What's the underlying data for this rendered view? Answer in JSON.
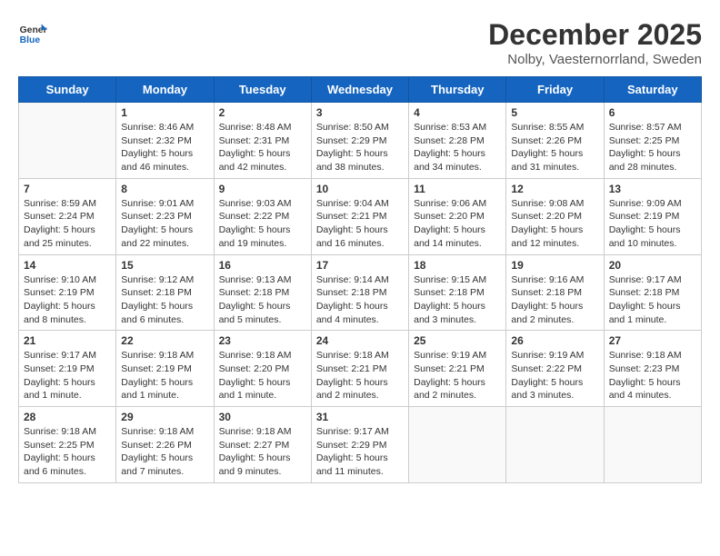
{
  "header": {
    "logo_line1": "General",
    "logo_line2": "Blue",
    "month": "December 2025",
    "location": "Nolby, Vaesternorrland, Sweden"
  },
  "days_of_week": [
    "Sunday",
    "Monday",
    "Tuesday",
    "Wednesday",
    "Thursday",
    "Friday",
    "Saturday"
  ],
  "weeks": [
    [
      {
        "day": "",
        "info": ""
      },
      {
        "day": "1",
        "info": "Sunrise: 8:46 AM\nSunset: 2:32 PM\nDaylight: 5 hours\nand 46 minutes."
      },
      {
        "day": "2",
        "info": "Sunrise: 8:48 AM\nSunset: 2:31 PM\nDaylight: 5 hours\nand 42 minutes."
      },
      {
        "day": "3",
        "info": "Sunrise: 8:50 AM\nSunset: 2:29 PM\nDaylight: 5 hours\nand 38 minutes."
      },
      {
        "day": "4",
        "info": "Sunrise: 8:53 AM\nSunset: 2:28 PM\nDaylight: 5 hours\nand 34 minutes."
      },
      {
        "day": "5",
        "info": "Sunrise: 8:55 AM\nSunset: 2:26 PM\nDaylight: 5 hours\nand 31 minutes."
      },
      {
        "day": "6",
        "info": "Sunrise: 8:57 AM\nSunset: 2:25 PM\nDaylight: 5 hours\nand 28 minutes."
      }
    ],
    [
      {
        "day": "7",
        "info": "Sunrise: 8:59 AM\nSunset: 2:24 PM\nDaylight: 5 hours\nand 25 minutes."
      },
      {
        "day": "8",
        "info": "Sunrise: 9:01 AM\nSunset: 2:23 PM\nDaylight: 5 hours\nand 22 minutes."
      },
      {
        "day": "9",
        "info": "Sunrise: 9:03 AM\nSunset: 2:22 PM\nDaylight: 5 hours\nand 19 minutes."
      },
      {
        "day": "10",
        "info": "Sunrise: 9:04 AM\nSunset: 2:21 PM\nDaylight: 5 hours\nand 16 minutes."
      },
      {
        "day": "11",
        "info": "Sunrise: 9:06 AM\nSunset: 2:20 PM\nDaylight: 5 hours\nand 14 minutes."
      },
      {
        "day": "12",
        "info": "Sunrise: 9:08 AM\nSunset: 2:20 PM\nDaylight: 5 hours\nand 12 minutes."
      },
      {
        "day": "13",
        "info": "Sunrise: 9:09 AM\nSunset: 2:19 PM\nDaylight: 5 hours\nand 10 minutes."
      }
    ],
    [
      {
        "day": "14",
        "info": "Sunrise: 9:10 AM\nSunset: 2:19 PM\nDaylight: 5 hours\nand 8 minutes."
      },
      {
        "day": "15",
        "info": "Sunrise: 9:12 AM\nSunset: 2:18 PM\nDaylight: 5 hours\nand 6 minutes."
      },
      {
        "day": "16",
        "info": "Sunrise: 9:13 AM\nSunset: 2:18 PM\nDaylight: 5 hours\nand 5 minutes."
      },
      {
        "day": "17",
        "info": "Sunrise: 9:14 AM\nSunset: 2:18 PM\nDaylight: 5 hours\nand 4 minutes."
      },
      {
        "day": "18",
        "info": "Sunrise: 9:15 AM\nSunset: 2:18 PM\nDaylight: 5 hours\nand 3 minutes."
      },
      {
        "day": "19",
        "info": "Sunrise: 9:16 AM\nSunset: 2:18 PM\nDaylight: 5 hours\nand 2 minutes."
      },
      {
        "day": "20",
        "info": "Sunrise: 9:17 AM\nSunset: 2:18 PM\nDaylight: 5 hours\nand 1 minute."
      }
    ],
    [
      {
        "day": "21",
        "info": "Sunrise: 9:17 AM\nSunset: 2:19 PM\nDaylight: 5 hours\nand 1 minute."
      },
      {
        "day": "22",
        "info": "Sunrise: 9:18 AM\nSunset: 2:19 PM\nDaylight: 5 hours\nand 1 minute."
      },
      {
        "day": "23",
        "info": "Sunrise: 9:18 AM\nSunset: 2:20 PM\nDaylight: 5 hours\nand 1 minute."
      },
      {
        "day": "24",
        "info": "Sunrise: 9:18 AM\nSunset: 2:21 PM\nDaylight: 5 hours\nand 2 minutes."
      },
      {
        "day": "25",
        "info": "Sunrise: 9:19 AM\nSunset: 2:21 PM\nDaylight: 5 hours\nand 2 minutes."
      },
      {
        "day": "26",
        "info": "Sunrise: 9:19 AM\nSunset: 2:22 PM\nDaylight: 5 hours\nand 3 minutes."
      },
      {
        "day": "27",
        "info": "Sunrise: 9:18 AM\nSunset: 2:23 PM\nDaylight: 5 hours\nand 4 minutes."
      }
    ],
    [
      {
        "day": "28",
        "info": "Sunrise: 9:18 AM\nSunset: 2:25 PM\nDaylight: 5 hours\nand 6 minutes."
      },
      {
        "day": "29",
        "info": "Sunrise: 9:18 AM\nSunset: 2:26 PM\nDaylight: 5 hours\nand 7 minutes."
      },
      {
        "day": "30",
        "info": "Sunrise: 9:18 AM\nSunset: 2:27 PM\nDaylight: 5 hours\nand 9 minutes."
      },
      {
        "day": "31",
        "info": "Sunrise: 9:17 AM\nSunset: 2:29 PM\nDaylight: 5 hours\nand 11 minutes."
      },
      {
        "day": "",
        "info": ""
      },
      {
        "day": "",
        "info": ""
      },
      {
        "day": "",
        "info": ""
      }
    ]
  ]
}
